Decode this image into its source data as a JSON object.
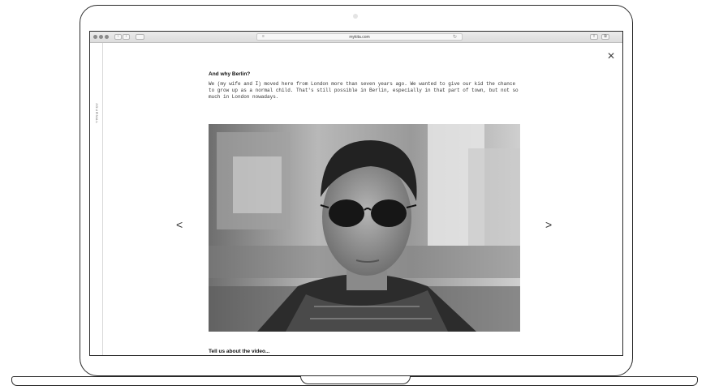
{
  "browser": {
    "url": "mykita.com"
  },
  "sidebar": {
    "label": "JOURNAL"
  },
  "article": {
    "heading": "And why Berlin?",
    "paragraph": "We (my wife and I) moved here from London more than seven years ago. We wanted to give our kid the chance to grow up as a normal child. That's still possible in Berlin, especially in that part of town, but not so much in London nowadays.",
    "next_heading": "Tell us about the video..."
  },
  "icons": {
    "close": "close-icon",
    "prev": "chevron-left-icon",
    "next": "chevron-right-icon"
  }
}
